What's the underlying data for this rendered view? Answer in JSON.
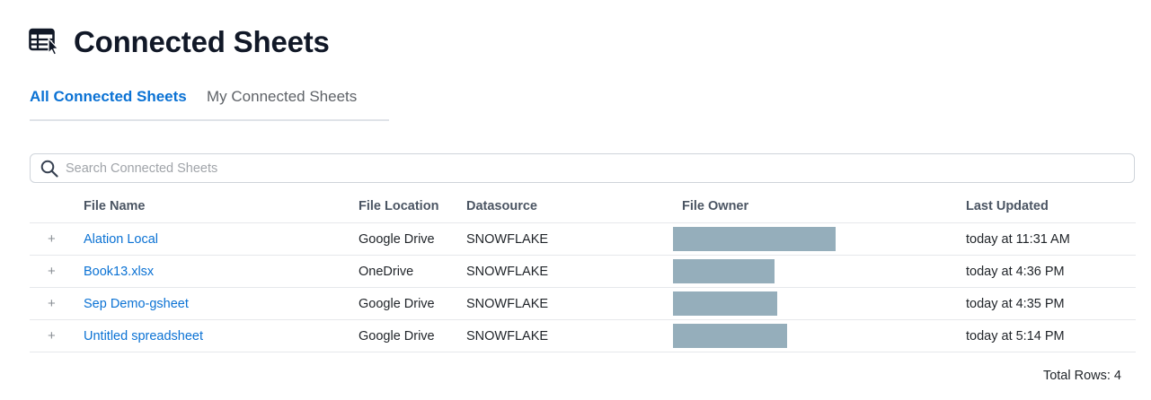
{
  "header": {
    "title": "Connected Sheets",
    "icon": "spreadsheet-cursor-icon"
  },
  "tabs": [
    {
      "label": "All Connected Sheets",
      "active": true
    },
    {
      "label": "My Connected Sheets",
      "active": false
    }
  ],
  "search": {
    "placeholder": "Search Connected Sheets",
    "value": ""
  },
  "table": {
    "columns": [
      "File Name",
      "File Location",
      "Datasource",
      "File Owner",
      "Last Updated"
    ],
    "rows": [
      {
        "expand": "+",
        "file_name": "Alation Local",
        "file_location": "Google Drive",
        "datasource": "SNOWFLAKE",
        "file_owner": "[redacted]",
        "last_updated": "today at 11:31 AM"
      },
      {
        "expand": "+",
        "file_name": "Book13.xlsx",
        "file_location": "OneDrive",
        "datasource": "SNOWFLAKE",
        "file_owner": "[redacted]",
        "last_updated": "today at 4:36 PM"
      },
      {
        "expand": "+",
        "file_name": "Sep Demo-gsheet",
        "file_location": "Google Drive",
        "datasource": "SNOWFLAKE",
        "file_owner": "[redacted]",
        "last_updated": "today at 4:35 PM"
      },
      {
        "expand": "+",
        "file_name": "Untitled spreadsheet",
        "file_location": "Google Drive",
        "datasource": "SNOWFLAKE",
        "file_owner": "[redacted]",
        "last_updated": "today at 5:14 PM"
      }
    ]
  },
  "footer": {
    "total_rows": "Total Rows: 4"
  },
  "colors": {
    "accent": "#0b72d4",
    "redaction": "#95aebb",
    "title": "#111827"
  }
}
